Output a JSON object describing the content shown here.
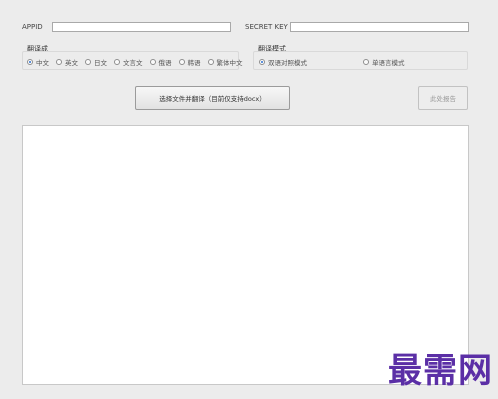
{
  "credentials": {
    "appid_label": "APPID",
    "appid_value": "",
    "secret_label": "SECRET KEY",
    "secret_value": ""
  },
  "target_language": {
    "title": "翻译成",
    "options": [
      {
        "label": "中文",
        "selected": true
      },
      {
        "label": "英文",
        "selected": false
      },
      {
        "label": "日文",
        "selected": false
      },
      {
        "label": "文言文",
        "selected": false
      },
      {
        "label": "俄语",
        "selected": false
      },
      {
        "label": "韩语",
        "selected": false
      },
      {
        "label": "繁体中文",
        "selected": false
      }
    ]
  },
  "translate_mode": {
    "title": "翻译模式",
    "options": [
      {
        "label": "双语对照模式",
        "selected": true
      },
      {
        "label": "单语言模式",
        "selected": false
      }
    ]
  },
  "actions": {
    "choose_file_label": "选择文件并翻译（目前仅支持docx）",
    "feedback_label": "此处报告"
  },
  "output": {
    "text": ""
  },
  "watermark": {
    "text": "最需网"
  }
}
